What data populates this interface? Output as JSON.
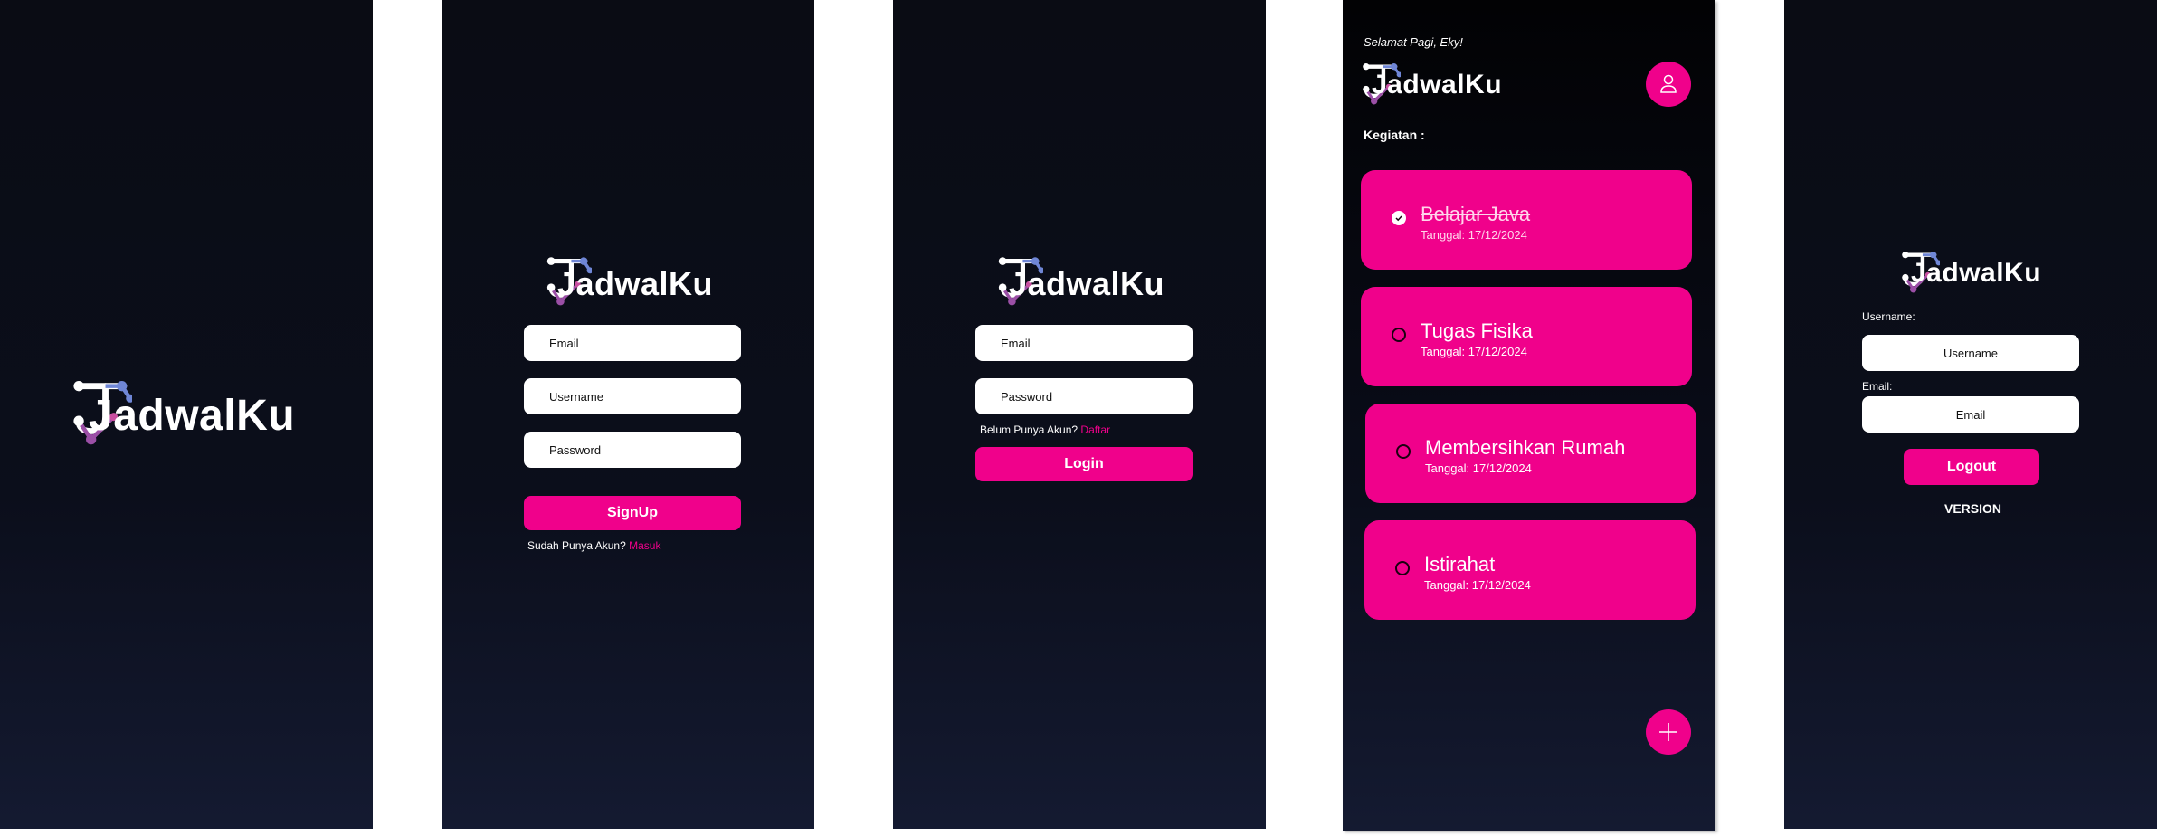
{
  "app": {
    "name": "JadwalKu"
  },
  "colors": {
    "accent": "#f0018b",
    "background": "#0b0e1b",
    "logo_blue": "#6f86d6",
    "logo_purple": "#9b4fa6"
  },
  "signup": {
    "email_placeholder": "Email",
    "username_placeholder": "Username",
    "password_placeholder": "Password",
    "submit_label": "SignUp",
    "footer_text": "Sudah Punya Akun?",
    "footer_link": "Masuk"
  },
  "login": {
    "email_placeholder": "Email",
    "password_placeholder": "Password",
    "prompt_text": "Belum Punya Akun?",
    "prompt_link": "Daftar",
    "submit_label": "Login"
  },
  "home": {
    "greeting": "Selamat Pagi, Eky!",
    "section_label": "Kegiatan :",
    "profile_icon": "user-icon",
    "add_icon": "plus-icon",
    "tasks": [
      {
        "title": "Belajar Java",
        "date": "Tanggal: 17/12/2024",
        "done": true
      },
      {
        "title": "Tugas Fisika",
        "date": "Tanggal: 17/12/2024",
        "done": false
      },
      {
        "title": "Membersihkan Rumah",
        "date": "Tanggal: 17/12/2024",
        "done": false
      },
      {
        "title": "Istirahat",
        "date": "Tanggal: 17/12/2024",
        "done": false
      }
    ]
  },
  "profile": {
    "username_label": "Username:",
    "username_value": "Username",
    "email_label": "Email:",
    "email_value": "Email",
    "logout_label": "Logout",
    "version_label": "VERSION"
  }
}
